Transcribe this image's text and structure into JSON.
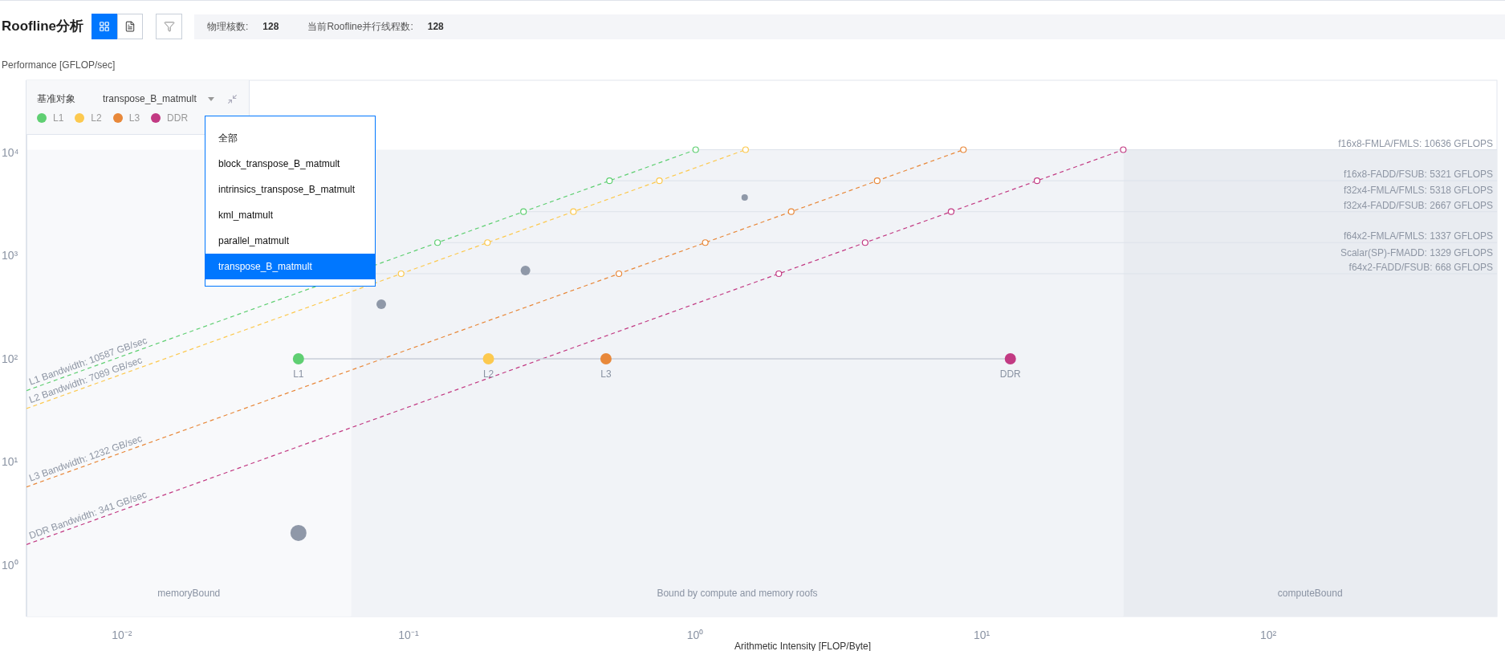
{
  "header": {
    "title": "Roofline分析",
    "view_buttons": [
      {
        "kind": "grid",
        "selected": true
      },
      {
        "kind": "list",
        "selected": false
      }
    ],
    "stats": [
      {
        "label": "物理核数:",
        "value": "128"
      },
      {
        "label": "当前Roofline并行线程数:",
        "value": "128"
      }
    ]
  },
  "chart": {
    "panel": {
      "label": "基准对象",
      "value": "transpose_B_matmult",
      "legend": [
        {
          "label": "L1",
          "color": "#5fcf72"
        },
        {
          "label": "L2",
          "color": "#fcc94f"
        },
        {
          "label": "L3",
          "color": "#e8883a"
        },
        {
          "label": "DDR",
          "color": "#c23a83"
        }
      ]
    },
    "dropdown": {
      "options": [
        {
          "label": "全部",
          "selected": false
        },
        {
          "label": "block_transpose_B_matmult",
          "selected": false
        },
        {
          "label": "intrinsics_transpose_B_matmult",
          "selected": false
        },
        {
          "label": "kml_matmult",
          "selected": false
        },
        {
          "label": "parallel_matmult",
          "selected": false
        },
        {
          "label": "transpose_B_matmult",
          "selected": true
        }
      ]
    },
    "plot": {
      "ylabel": "Performance [GFLOP/sec]",
      "xlabel": "Arithmetic Intensity [FLOP/Byte]",
      "x_ticks": [
        "10⁻²",
        "10⁻¹",
        "10⁰",
        "10¹",
        "10²"
      ],
      "y_ticks": [
        "10⁴",
        "10³",
        "10²",
        "10¹",
        "10⁰"
      ],
      "compute_roofs": [
        "f16x8-FMLA/FMLS: 10636 GFLOPS",
        "f16x8-FADD/FSUB: 5321 GFLOPS",
        "f32x4-FMLA/FMLS: 5318 GFLOPS",
        "f32x4-FADD/FSUB: 2667 GFLOPS",
        "f64x2-FMLA/FMLS: 1337 GFLOPS",
        "Scalar(SP)-FMADD: 1329 GFLOPS",
        "f64x2-FADD/FSUB: 668 GFLOPS"
      ],
      "bandwidth_roofs": [
        {
          "label": "L1 Bandwidth: 10587 GB/sec",
          "color": "#5fcf72"
        },
        {
          "label": "L2 Bandwidth: 7089 GB/sec",
          "color": "#fcc94f"
        },
        {
          "label": "L3 Bandwidth: 1232 GB/sec",
          "color": "#e8883a"
        },
        {
          "label": "DDR Bandwidth: 341 GB/sec",
          "color": "#c23a83"
        }
      ],
      "regions": [
        {
          "label": "memoryBound",
          "color": "#f8f9fb"
        },
        {
          "label": "Bound by compute and memory roofs",
          "color": "#f1f3f7"
        },
        {
          "label": "computeBound",
          "color": "#e9ecf1"
        }
      ],
      "levels": [
        {
          "label": "L1",
          "color": "#5fcf72"
        },
        {
          "label": "L2",
          "color": "#fcc94f"
        },
        {
          "label": "L3",
          "color": "#e8883a"
        },
        {
          "label": "DDR",
          "color": "#c23a83"
        }
      ]
    }
  }
}
